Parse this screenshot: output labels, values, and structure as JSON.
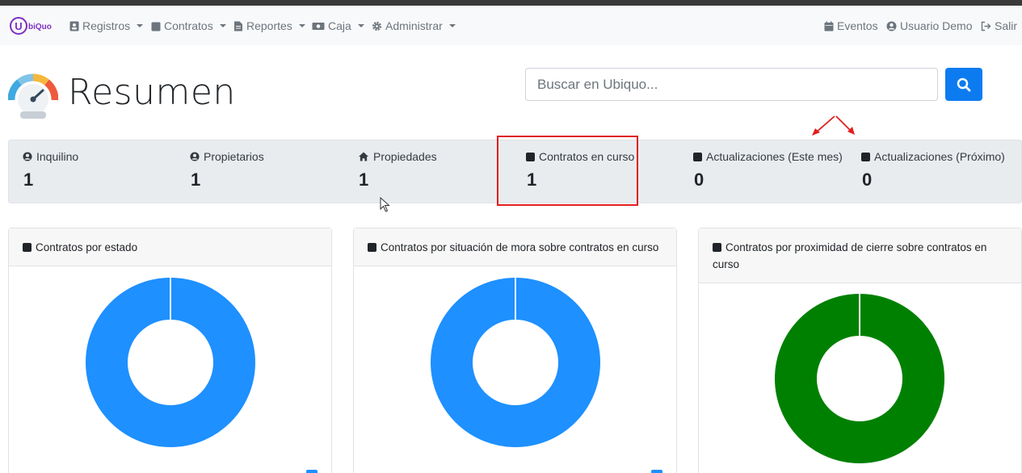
{
  "brand": {
    "logo_letter": "U",
    "logo_text": "biQuo"
  },
  "nav": {
    "left": [
      {
        "label": "Registros",
        "icon": "address-card-icon"
      },
      {
        "label": "Contratos",
        "icon": "square-icon"
      },
      {
        "label": "Reportes",
        "icon": "file-icon"
      },
      {
        "label": "Caja",
        "icon": "money-bill-icon"
      },
      {
        "label": "Administrar",
        "icon": "gear-icon"
      }
    ],
    "right": [
      {
        "label": "Eventos",
        "icon": "calendar-icon"
      },
      {
        "label": "Usuario Demo",
        "icon": "user-circle-icon"
      },
      {
        "label": "Salir",
        "icon": "sign-out-icon"
      }
    ]
  },
  "page": {
    "title": "Resumen",
    "icon": "speedometer-icon"
  },
  "search": {
    "placeholder": "Buscar en Ubiquo...",
    "button_icon": "search-icon"
  },
  "stats": [
    {
      "label": "Inquilino",
      "value": "1",
      "icon": "user-circle-icon"
    },
    {
      "label": "Propietarios",
      "value": "1",
      "icon": "user-circle-icon"
    },
    {
      "label": "Propiedades",
      "value": "1",
      "icon": "home-icon"
    },
    {
      "label": "Contratos en curso",
      "value": "1",
      "icon": "square-icon",
      "highlighted": true
    },
    {
      "label": "Actualizaciones (Este mes)",
      "value": "0",
      "icon": "square-icon"
    },
    {
      "label": "Actualizaciones (Próximo)",
      "value": "0",
      "icon": "square-icon"
    }
  ],
  "cards": [
    {
      "title": "Contratos por estado",
      "icon": "square-icon"
    },
    {
      "title": "Contratos por situación de mora sobre contratos en curso",
      "icon": "square-icon"
    },
    {
      "title": "Contratos por proximidad de cierre sobre contratos en curso",
      "icon": "square-icon"
    }
  ],
  "colors": {
    "accent": "#0d7bf0",
    "donut_blue": "#1e90ff",
    "donut_green": "#008000",
    "highlight": "#e01e1e",
    "annotation_arrow": "#e01e1e"
  },
  "chart_data": [
    {
      "type": "pie",
      "values": [
        1
      ],
      "colors": [
        "#1e90ff"
      ]
    },
    {
      "type": "pie",
      "values": [
        1
      ],
      "colors": [
        "#1e90ff"
      ]
    },
    {
      "type": "pie",
      "values": [
        1
      ],
      "colors": [
        "#008000"
      ]
    }
  ]
}
